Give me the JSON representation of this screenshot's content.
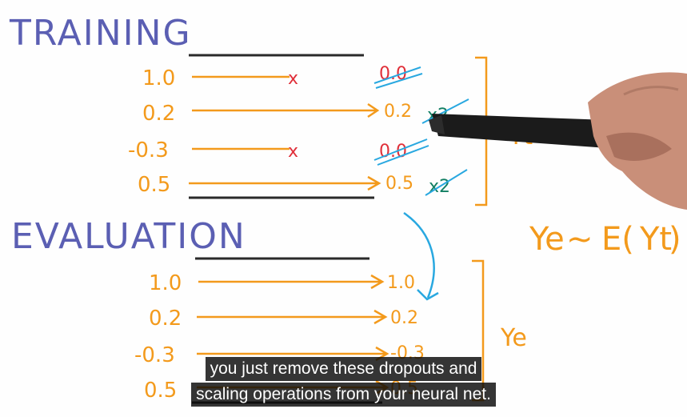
{
  "training": {
    "title": "TRAINING",
    "inputs": [
      "1.0",
      "0.2",
      "-0.3",
      "0.5"
    ],
    "outputs": [
      "0.0",
      "0.2",
      "0.0",
      "0.5"
    ],
    "dropout_mark": "x",
    "scale_labels": [
      "x2",
      "x2"
    ],
    "bracket_label": "Yt"
  },
  "evaluation": {
    "title": "EVALUATION",
    "inputs": [
      "1.0",
      "0.2",
      "-0.3",
      "0.5"
    ],
    "outputs": [
      "1.0",
      "0.2",
      "-0.3",
      "0.5"
    ],
    "bracket_label": "Ye"
  },
  "expectation": {
    "left": "Ye",
    "tilde": "~",
    "func": "E(",
    "arg": "Yt",
    "close": ")"
  },
  "captions": {
    "line1": "you just remove these dropouts and",
    "line2": "scaling operations from your neural net."
  },
  "colors": {
    "orange": "#f39a1c",
    "blue_title": "#5b5fb3",
    "dropout_red": "#e0303a",
    "teal": "#127f63",
    "cyan": "#29a8e0"
  }
}
